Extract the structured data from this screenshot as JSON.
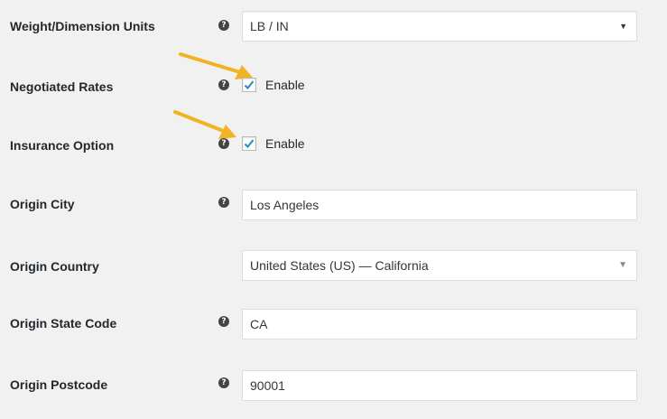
{
  "fields": {
    "weight_units": {
      "label": "Weight/Dimension Units",
      "value": "LB / IN",
      "caret": "▼"
    },
    "negotiated_rates": {
      "label": "Negotiated Rates",
      "checkbox_label": "Enable",
      "checked": true
    },
    "insurance_option": {
      "label": "Insurance Option",
      "checkbox_label": "Enable",
      "checked": true
    },
    "origin_city": {
      "label": "Origin City",
      "value": "Los Angeles"
    },
    "origin_country": {
      "label": "Origin Country",
      "value": "United States (US) — California",
      "caret": "▼"
    },
    "origin_state_code": {
      "label": "Origin State Code",
      "value": "CA"
    },
    "origin_postcode": {
      "label": "Origin Postcode",
      "value": "90001"
    }
  },
  "help_icon": "?",
  "colors": {
    "background": "#f1f1f1",
    "checkmark": "#1e8cbe",
    "arrow": "#f0b323",
    "help_icon": "#444444"
  }
}
